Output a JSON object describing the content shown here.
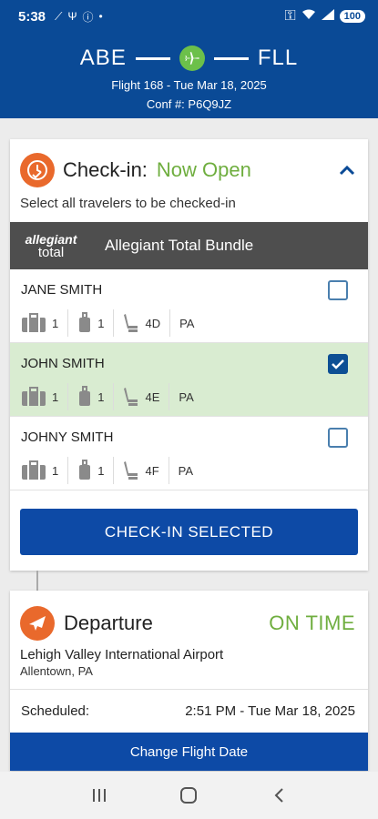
{
  "status_bar": {
    "time": "5:38",
    "battery": "100"
  },
  "header": {
    "origin": "ABE",
    "destination": "FLL",
    "flight_info": "Flight 168 - Tue Mar 18, 2025",
    "conf_label": "Conf #:",
    "conf_code": "P6Q9JZ"
  },
  "checkin": {
    "title": "Check-in:",
    "status": "Now Open",
    "subtitle": "Select all travelers to be checked-in",
    "bundle_logo_line1": "allegiant",
    "bundle_logo_line2": "total",
    "bundle_name": "Allegiant Total Bundle",
    "passengers": [
      {
        "name": "JANE SMITH",
        "bags": "1",
        "carry_on": "1",
        "seat": "4D",
        "pa": "PA",
        "checked": false
      },
      {
        "name": "JOHN SMITH",
        "bags": "1",
        "carry_on": "1",
        "seat": "4E",
        "pa": "PA",
        "checked": true
      },
      {
        "name": "JOHNY SMITH",
        "bags": "1",
        "carry_on": "1",
        "seat": "4F",
        "pa": "PA",
        "checked": false
      }
    ],
    "button_label": "CHECK-IN SELECTED"
  },
  "departure": {
    "title": "Departure",
    "status": "ON TIME",
    "airport": "Lehigh Valley International Airport",
    "city": "Allentown, PA",
    "scheduled_label": "Scheduled:",
    "scheduled_value": "2:51 PM - Tue Mar 18, 2025",
    "change_button": "Change Flight Date"
  },
  "colors": {
    "brand_blue": "#0a4a96",
    "accent_green": "#6fae3f",
    "accent_orange": "#e9692c",
    "selected_row": "#d9ecd1"
  }
}
